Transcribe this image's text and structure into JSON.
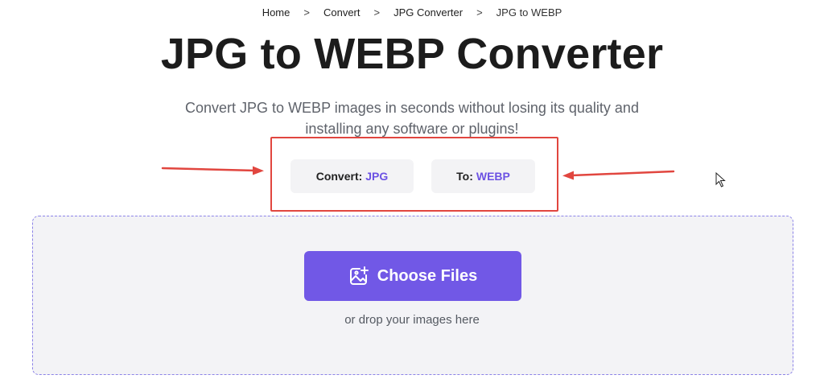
{
  "breadcrumb": {
    "items": [
      "Home",
      "Convert",
      "JPG Converter"
    ],
    "separator": ">",
    "current": "JPG to WEBP"
  },
  "header": {
    "title": "JPG to WEBP Converter",
    "subtitle_line1": "Convert JPG to WEBP images in seconds without losing its quality and",
    "subtitle_line2": "installing any software or plugins!"
  },
  "formats": {
    "from_label": "Convert:",
    "from_value": "JPG",
    "to_label": "To:",
    "to_value": "WEBP"
  },
  "upload": {
    "button_label": "Choose Files",
    "button_icon": "add-image-icon",
    "hint": "or drop your images here"
  },
  "colors": {
    "accent": "#7158e6",
    "annotation": "#e1463f",
    "dropzone_border": "#8c83e8"
  }
}
